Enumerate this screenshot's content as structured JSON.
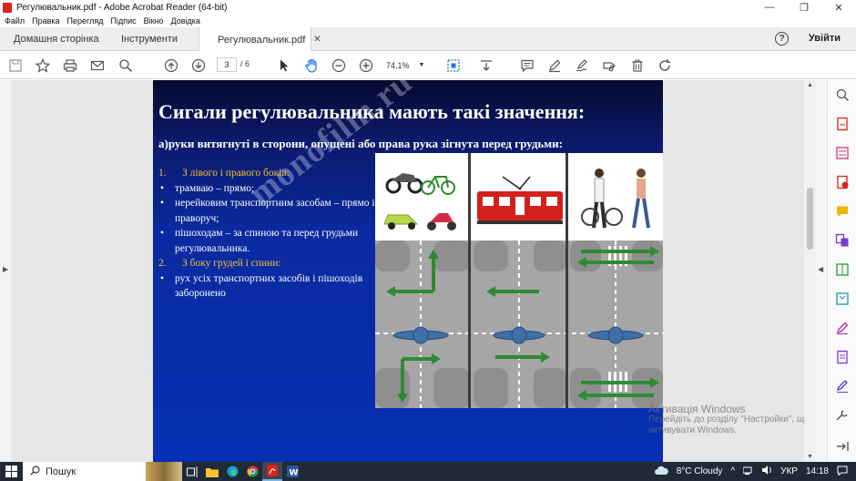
{
  "window": {
    "title": "Регулювальник.pdf - Adobe Acrobat Reader (64-bit)",
    "min": "—",
    "max": "❐",
    "close": "✕"
  },
  "menu": [
    "Файл",
    "Правка",
    "Перегляд",
    "Підпис",
    "Вікно",
    "Довідка"
  ],
  "tabs": {
    "home": "Домашня сторінка",
    "tools": "Інструменти",
    "doc": "Регулювальник.pdf",
    "close": "✕",
    "help": "?",
    "signin": "Увійти"
  },
  "toolbar": {
    "page_current": "3",
    "page_total": "/ 6",
    "zoom": "74,1%",
    "zoom_caret": "▼"
  },
  "slide": {
    "title": "Сигали регулювальника мають такі значення:",
    "subtitle": "а)руки витягнуті в сторони, опущені або права рука зігнута перед грудьми:",
    "items": [
      {
        "kind": "num",
        "n": "1.",
        "text": "З лівого і правого боків:"
      },
      {
        "kind": "bullet",
        "text": "трамваю – прямо;"
      },
      {
        "kind": "bullet",
        "text": "нерейковим транспортним засобам – прямо і праворуч;"
      },
      {
        "kind": "bullet",
        "text": "пішоходам – за спиною та перед грудьми регулювальника."
      },
      {
        "kind": "num",
        "n": "2.",
        "text": "З боку грудей і спини:"
      },
      {
        "kind": "bullet",
        "text": "рух усіх транспортних засобів і пішоходів заборонено"
      }
    ],
    "watermark": "monofilm.ru"
  },
  "overlay": {
    "activate_line1": "Активація Windows",
    "activate_line2": "Перейдіть до розділу \"Настройки\", щоб",
    "activate_line3": "активувати Windows."
  },
  "taskbar": {
    "search": "Пошук",
    "weather": "8°C  Cloudy",
    "lang": "УКР",
    "time": "14:18"
  },
  "colors": {
    "accent_blue": "#0630b4",
    "orange_text": "#f7c232",
    "adobe_red": "#d9231c",
    "tram_red": "#d41f1f",
    "arrow_green": "#2f8a34"
  }
}
